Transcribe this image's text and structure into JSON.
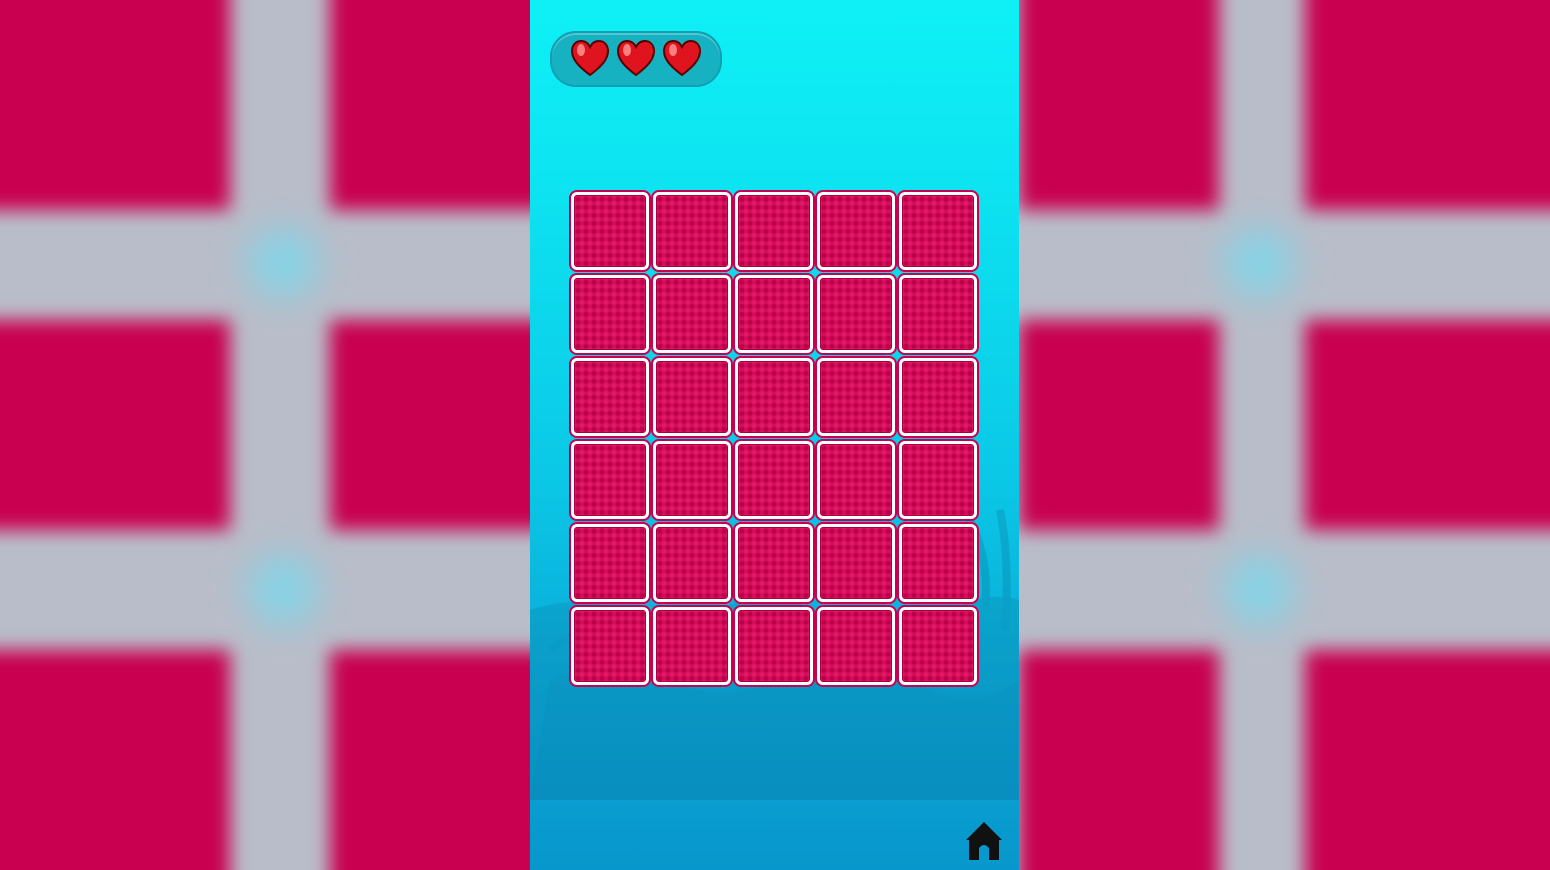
{
  "game": {
    "type": "memory-match",
    "lives": 3,
    "grid": {
      "rows": 6,
      "columns": 5
    },
    "cards": [
      {
        "state": "face-down"
      },
      {
        "state": "face-down"
      },
      {
        "state": "face-down"
      },
      {
        "state": "face-down"
      },
      {
        "state": "face-down"
      },
      {
        "state": "face-down"
      },
      {
        "state": "face-down"
      },
      {
        "state": "face-down"
      },
      {
        "state": "face-down"
      },
      {
        "state": "face-down"
      },
      {
        "state": "face-down"
      },
      {
        "state": "face-down"
      },
      {
        "state": "face-down"
      },
      {
        "state": "face-down"
      },
      {
        "state": "face-down"
      },
      {
        "state": "face-down"
      },
      {
        "state": "face-down"
      },
      {
        "state": "face-down"
      },
      {
        "state": "face-down"
      },
      {
        "state": "face-down"
      },
      {
        "state": "face-down"
      },
      {
        "state": "face-down"
      },
      {
        "state": "face-down"
      },
      {
        "state": "face-down"
      },
      {
        "state": "face-down"
      },
      {
        "state": "face-down"
      },
      {
        "state": "face-down"
      },
      {
        "state": "face-down"
      },
      {
        "state": "face-down"
      },
      {
        "state": "face-down"
      }
    ]
  },
  "icons": {
    "life": "heart-icon",
    "home": "home-icon"
  },
  "colors": {
    "card_back": "#d40c5a",
    "card_border": "#ffffff",
    "sky_top": "#0ff0f6",
    "sea_bottom": "#0897cc",
    "lives_panel": "#17b2c2",
    "heart": "#e0141e",
    "backdrop_tile": "#c8004f"
  }
}
